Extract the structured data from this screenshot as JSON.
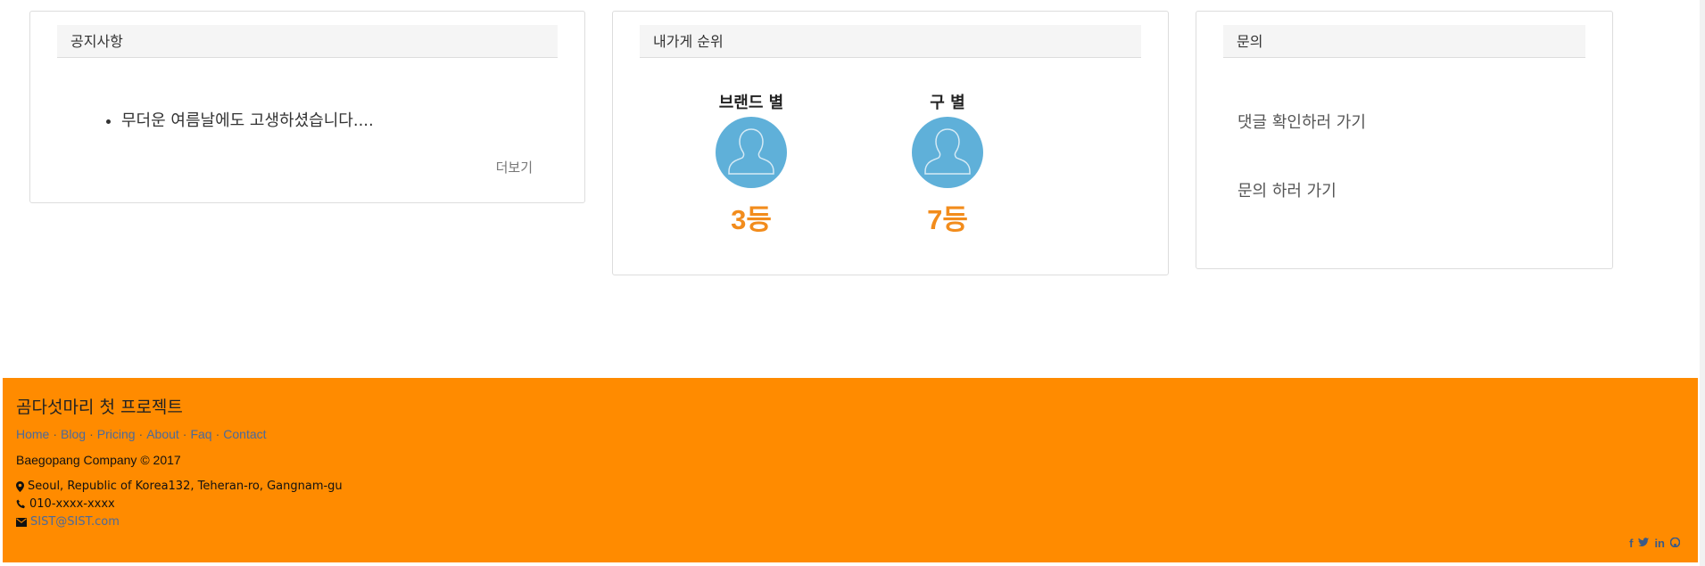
{
  "notice": {
    "title": "공지사항",
    "items": [
      "무더운 여름날에도 고생하셨습니다...."
    ],
    "more_label": "더보기"
  },
  "rank": {
    "title": "내가게 순위",
    "brand": {
      "label": "브랜드 별",
      "value": "3등"
    },
    "gu": {
      "label": "구 별",
      "value": "7등"
    }
  },
  "inquiry": {
    "title": "문의",
    "comment_link": "댓글 확인하러 가기",
    "inquiry_link": "문의 하러 가기"
  },
  "footer": {
    "title": "곰다섯마리 첫 프로젝트",
    "links": [
      "Home",
      "Blog",
      "Pricing",
      "About",
      "Faq",
      "Contact"
    ],
    "separator": "·",
    "company": "Baegopang Company © 2017",
    "address": "Seoul, Republic of Korea132, Teheran-ro, Gangnam-gu",
    "phone": "010-xxxx-xxxx",
    "email": "SIST@SIST.com",
    "social": [
      "f",
      "t",
      "in",
      "gh"
    ]
  },
  "colors": {
    "footer_bg": "#ff8b00",
    "rank_value": "#f28c1c",
    "avatar_bg": "#5fb0d9"
  }
}
